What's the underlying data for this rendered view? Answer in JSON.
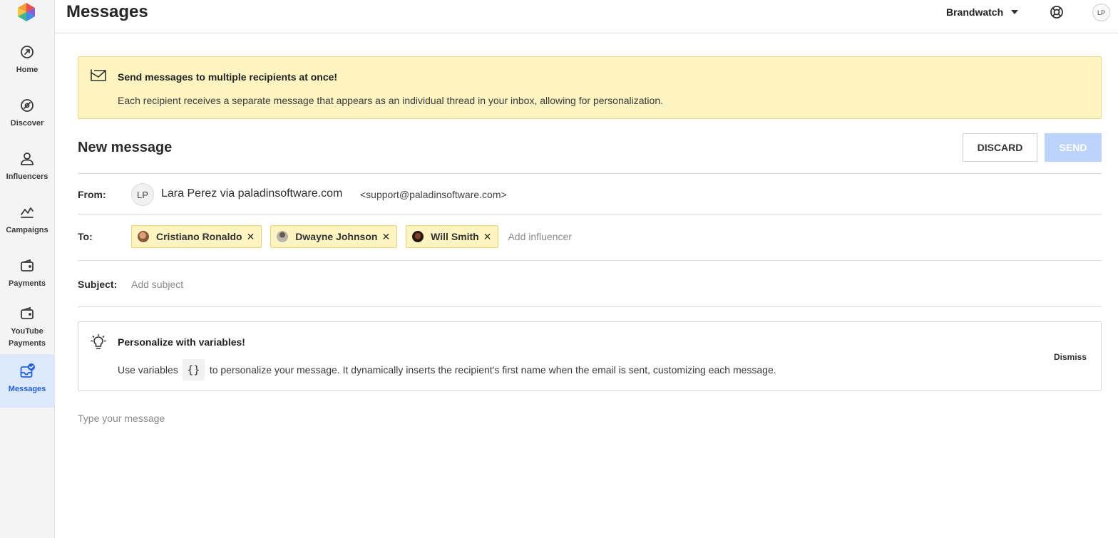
{
  "sidebar": {
    "items": [
      {
        "label": "Home",
        "icon": "home-icon"
      },
      {
        "label": "Discover",
        "icon": "discover-icon"
      },
      {
        "label": "Influencers",
        "icon": "person-icon"
      },
      {
        "label": "Campaigns",
        "icon": "campaign-chart-icon"
      },
      {
        "label": "Payments",
        "icon": "wallet-icon"
      },
      {
        "label": "YouTube\nPayments",
        "icon": "wallet-icon"
      },
      {
        "label": "Messages",
        "icon": "inbox-check-icon",
        "active": true
      }
    ],
    "active_color": "#2460d8"
  },
  "header": {
    "title": "Messages",
    "org_name": "Brandwatch",
    "user_initials": "LP"
  },
  "banner": {
    "title": "Send messages to multiple recipients at once!",
    "text": "Each recipient receives a separate message that appears as an individual thread in your inbox, allowing for personalization."
  },
  "composer": {
    "title": "New message",
    "discard_label": "DISCARD",
    "send_label": "SEND",
    "from_label": "From:",
    "from_initials": "LP",
    "from_name": "Lara Perez via paladinsoftware.com",
    "from_email": "<support@paladinsoftware.com>",
    "to_label": "To:",
    "recipients": [
      {
        "name": "Cristiano Ronaldo",
        "remove": "✕"
      },
      {
        "name": "Dwayne Johnson",
        "remove": "✕"
      },
      {
        "name": "Will Smith",
        "remove": "✕"
      }
    ],
    "to_placeholder": "Add influencer",
    "subject_label": "Subject:",
    "subject_placeholder": "Add subject",
    "message_placeholder": "Type your message"
  },
  "tip": {
    "title": "Personalize with variables!",
    "text_before": "Use variables",
    "variable_token": "{}",
    "text_after": "to personalize your message. It dynamically inserts the recipient's first name when the email is sent, customizing each message.",
    "dismiss_label": "Dismiss"
  }
}
